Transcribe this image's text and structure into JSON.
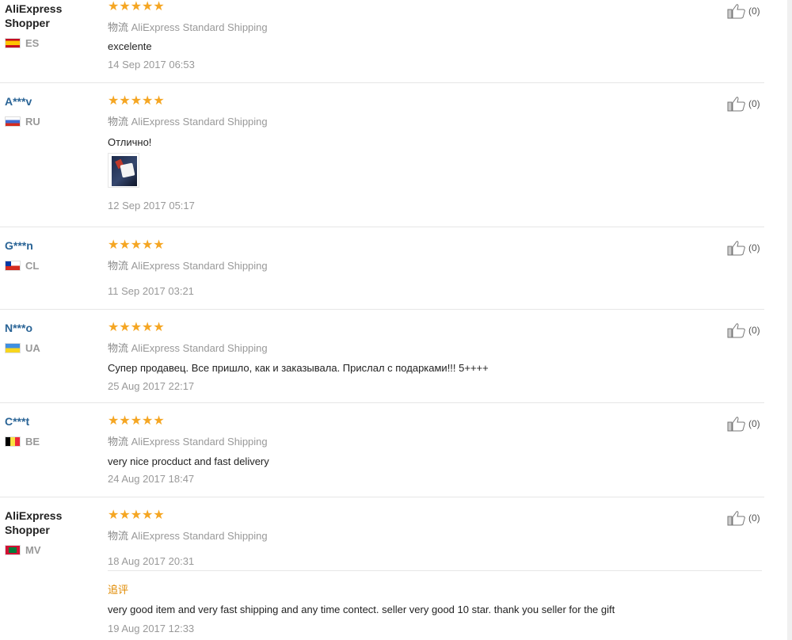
{
  "shipping_cn": "物流",
  "shipping_method": "AliExpress Standard Shipping",
  "colors": {
    "star": "#f5a623",
    "username": "#2a6496",
    "additional": "#e08a00"
  },
  "reviews": [
    {
      "name": "AliExpress Shopper",
      "country": "ES",
      "flag": "es",
      "stars": 5,
      "text": "excelente",
      "date": "14 Sep 2017 06:53",
      "likes": "(0)"
    },
    {
      "name": "A***v",
      "country": "RU",
      "flag": "ru",
      "stars": 5,
      "text": "Отлично!",
      "date": "12 Sep 2017 05:17",
      "likes": "(0)",
      "has_image": true
    },
    {
      "name": "G***n",
      "country": "CL",
      "flag": "cl",
      "stars": 5,
      "text": "",
      "date": "11 Sep 2017 03:21",
      "likes": "(0)"
    },
    {
      "name": "N***o",
      "country": "UA",
      "flag": "ua",
      "stars": 5,
      "text": "Супер продавец. Все пришло, как и заказывала. Прислал с подарками!!! 5++++",
      "date": "25 Aug 2017 22:17",
      "likes": "(0)"
    },
    {
      "name": "C***t",
      "country": "BE",
      "flag": "be",
      "stars": 5,
      "text": "very nice procduct and fast delivery",
      "date": "24 Aug 2017 18:47",
      "likes": "(0)"
    },
    {
      "name": "AliExpress Shopper",
      "country": "MV",
      "flag": "mv",
      "stars": 5,
      "text": "",
      "date": "18 Aug 2017 20:31",
      "likes": "(0)",
      "additional": {
        "label": "追评",
        "text": "very good item and very fast shipping and any time contect. seller very good 10 star. thank you seller for the gift",
        "date": "19 Aug 2017 12:33"
      }
    }
  ]
}
